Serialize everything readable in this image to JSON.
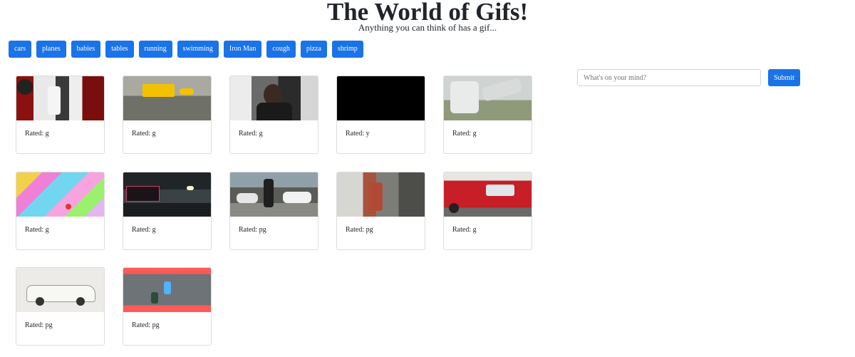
{
  "header": {
    "title": "The World of Gifs!",
    "subtitle": "Anything you can think of has a gif..."
  },
  "topics": [
    "cars",
    "planes",
    "babies",
    "tables",
    "running",
    "swimming",
    "Iron Man",
    "cough",
    "pizza",
    "shrimp"
  ],
  "search": {
    "placeholder": "What's on your mind?",
    "submit_label": "Submit"
  },
  "gifs": [
    {
      "rating": "Rated: g",
      "thumb": "mechanic-garage-image"
    },
    {
      "rating": "Rated: g",
      "thumb": "yellow-car-barrier-image"
    },
    {
      "rating": "Rated: g",
      "thumb": "man-in-crowd-image"
    },
    {
      "rating": "Rated: y",
      "thumb": "black-image"
    },
    {
      "rating": "Rated: g",
      "thumb": "car-lifted-by-truck-image"
    },
    {
      "rating": "Rated: g",
      "thumb": "colorful-pixel-city-image"
    },
    {
      "rating": "Rated: g",
      "thumb": "chateau-marmont-night-image"
    },
    {
      "rating": "Rated: pg",
      "thumb": "man-with-sports-cars-image"
    },
    {
      "rating": "Rated: pg",
      "thumb": "junkyard-scene-image"
    },
    {
      "rating": "Rated: g",
      "thumb": "red-car-dog-image"
    },
    {
      "rating": "Rated: pg",
      "thumb": "vintage-white-sedan-image"
    },
    {
      "rating": "Rated: pg",
      "thumb": "top-down-road-game-image"
    }
  ]
}
